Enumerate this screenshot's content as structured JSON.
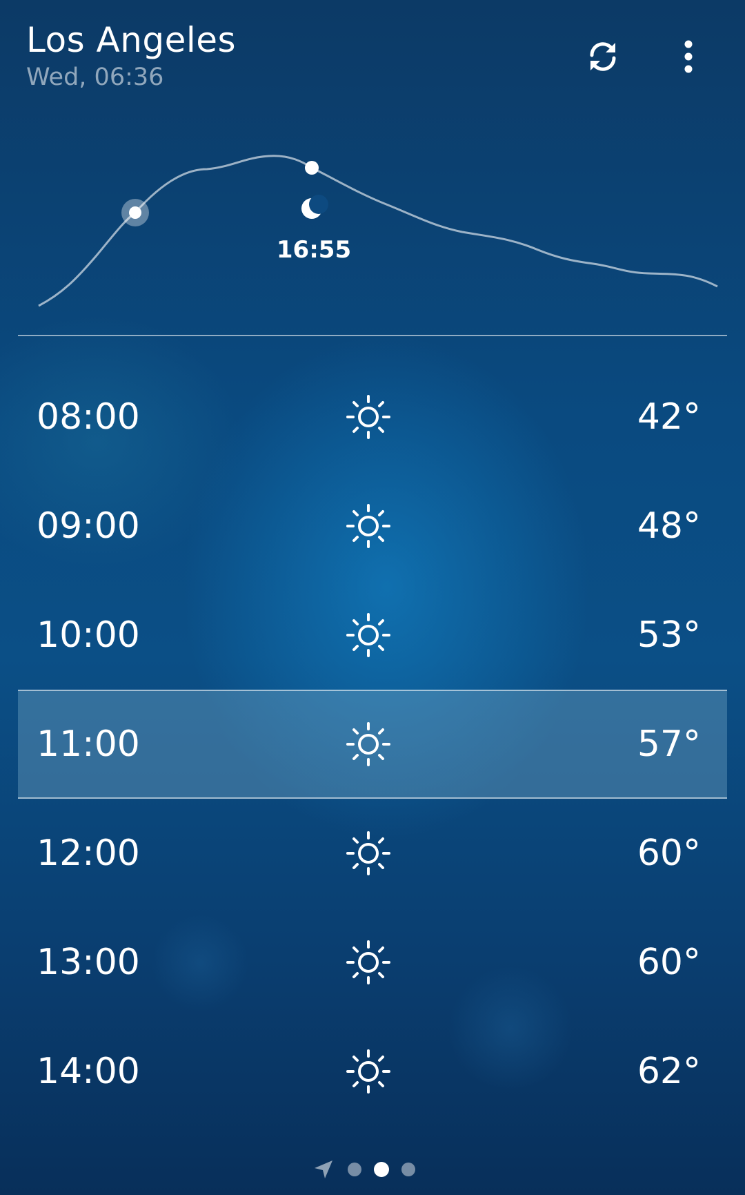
{
  "header": {
    "city": "Los Angeles",
    "datetime": "Wed, 06:36"
  },
  "toolbar": {
    "refresh_icon": "refresh-icon",
    "menu_icon": "more-vertical-icon"
  },
  "sun_graph": {
    "moon_icon": "crescent-moon-icon",
    "sunset_time": "16:55"
  },
  "hourly": [
    {
      "time": "08:00",
      "icon": "sun-icon",
      "temp": "42°",
      "current": false
    },
    {
      "time": "09:00",
      "icon": "sun-icon",
      "temp": "48°",
      "current": false
    },
    {
      "time": "10:00",
      "icon": "sun-icon",
      "temp": "53°",
      "current": false
    },
    {
      "time": "11:00",
      "icon": "sun-icon",
      "temp": "57°",
      "current": true
    },
    {
      "time": "12:00",
      "icon": "sun-icon",
      "temp": "60°",
      "current": false
    },
    {
      "time": "13:00",
      "icon": "sun-icon",
      "temp": "60°",
      "current": false
    },
    {
      "time": "14:00",
      "icon": "sun-icon",
      "temp": "62°",
      "current": false
    }
  ],
  "pager": {
    "location_icon": "location-arrow-icon",
    "pages": 3,
    "active_page": 2
  },
  "colors": {
    "background_top": "#0c3a66",
    "background_mid": "#0b4f86",
    "highlight_row": "#5a8fb0"
  }
}
